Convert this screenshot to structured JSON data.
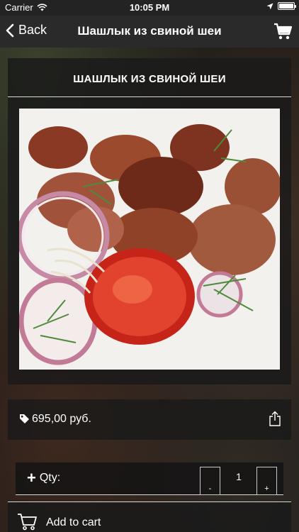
{
  "status_bar": {
    "carrier": "Carrier",
    "time": "10:05 PM",
    "battery_level": 1.0
  },
  "nav": {
    "back_label": "Back",
    "title": "Шашлык из свиной шеи",
    "cart_icon": "cart-icon"
  },
  "product": {
    "title": "ШАШЛЫК ИЗ СВИНОЙ ШЕИ",
    "price": "695,00 руб.",
    "image_icon": "food-photo"
  },
  "quantity": {
    "label": "Qty:",
    "value": "1",
    "minus_label": "-",
    "plus_label": "+"
  },
  "actions": {
    "add_to_cart_label": "Add to cart"
  },
  "colors": {
    "nav_background": "#2a2a2a",
    "text": "#ffffff",
    "divider": "#d8d8d8"
  }
}
